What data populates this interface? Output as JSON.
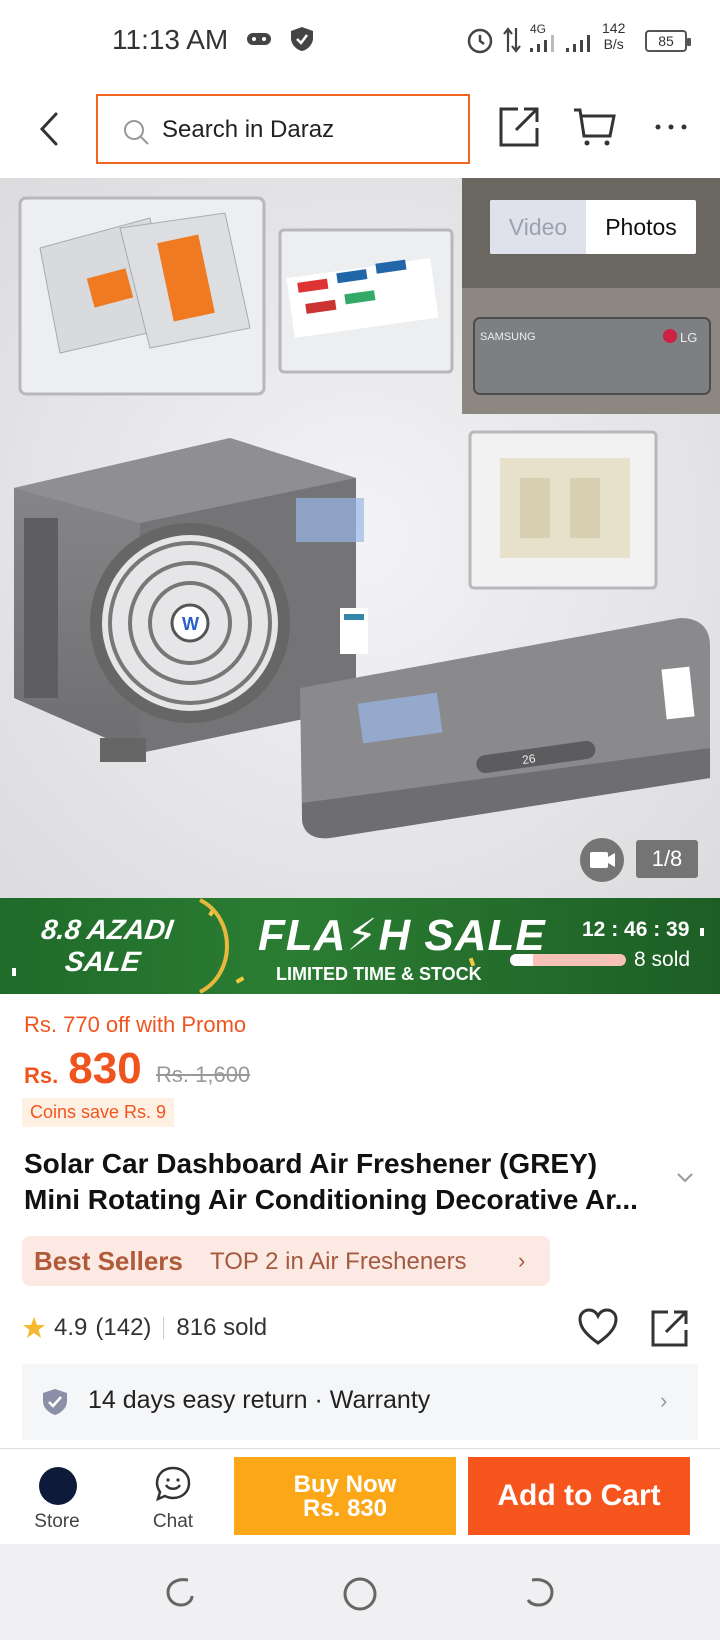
{
  "status_bar": {
    "time": "11:13 AM",
    "network": "4G",
    "speed_value": "142",
    "speed_unit": "B/s",
    "battery": "85",
    "icons": [
      "gamepad-icon",
      "shield-icon",
      "alarm-icon",
      "data-arrows-icon",
      "signal-icon",
      "signal-icon",
      "battery-icon"
    ]
  },
  "top_bar": {
    "search_placeholder": "Search in Daraz",
    "icons": [
      "back-icon",
      "search-icon",
      "share-icon",
      "cart-icon",
      "more-icon"
    ]
  },
  "gallery": {
    "tab_video": "Video",
    "tab_photos": "Photos",
    "active_tab": "Photos",
    "counter": "1/8",
    "image_text": [
      "SAMSUNG",
      "LG",
      "26"
    ]
  },
  "flash_sale": {
    "campaign": "8.8 AZADI SALE",
    "campaign_line1": "8.8 AZADI",
    "campaign_line2": "SALE",
    "title": "FLA⚡H SALE",
    "subtitle": "LIMITED TIME & STOCK",
    "timer": "12 : 46 : 39",
    "sold": "8 sold",
    "progress": 0.2
  },
  "product": {
    "promo": "Rs. 770 off with Promo",
    "currency": "Rs.",
    "price": "830",
    "original_price": "Rs. 1,600",
    "coins": "Coins save Rs. 9",
    "title_line1": "Solar Car Dashboard Air Freshener (GREY)",
    "title_line2": "Mini Rotating Air Conditioning Decorative Ar...",
    "best_sellers_label": "Best Sellers",
    "best_sellers_rank": "TOP 2 in Air Fresheners",
    "rating": "4.9",
    "rating_count": "(142)",
    "sold": "816 sold",
    "service": "14 days easy return  ·  Warranty"
  },
  "action_bar": {
    "store_label": "Store",
    "chat_label": "Chat",
    "buy_now_line1": "Buy Now",
    "buy_now_line2": "Rs. 830",
    "add_to_cart": "Add to Cart"
  },
  "colors": {
    "accent": "#f6561e",
    "buy_now": "#fba717",
    "flash_green": "#2b7d33"
  }
}
